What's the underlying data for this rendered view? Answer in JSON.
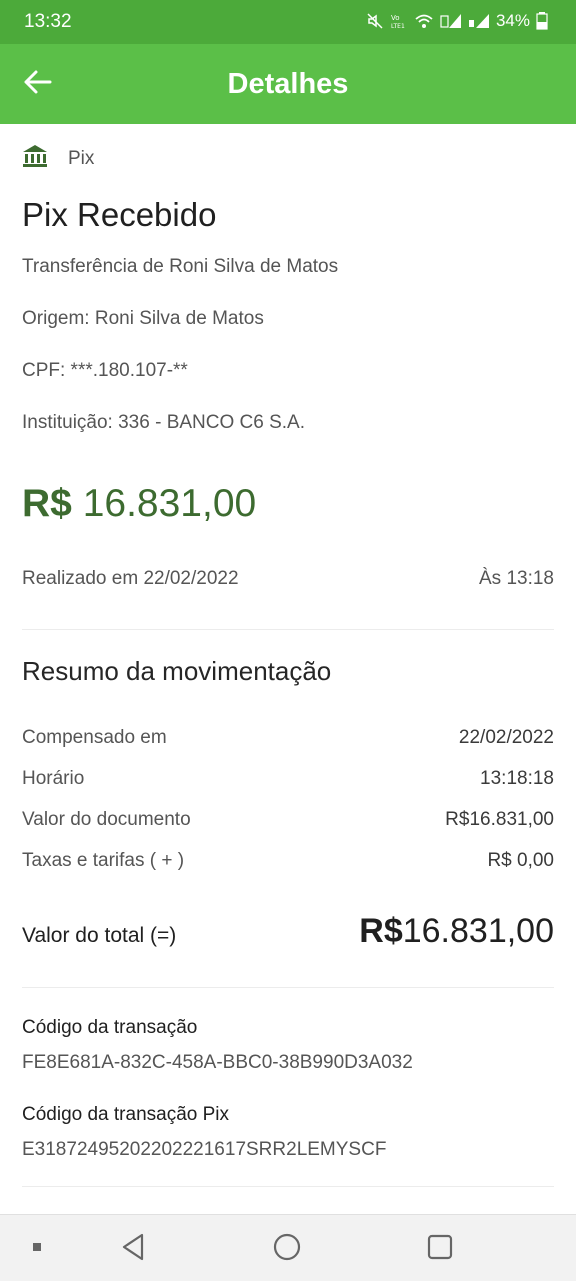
{
  "status_bar": {
    "time": "13:32",
    "battery_percent": "34%",
    "icons": [
      "mute-icon",
      "volte-icon",
      "wifi-icon",
      "signal-icon",
      "signal-icon",
      "battery-icon"
    ]
  },
  "app_bar": {
    "title": "Detalhes",
    "back_icon": "arrow-left-icon",
    "color": "#5bbf48"
  },
  "transaction": {
    "category_icon": "bank-icon",
    "category": "Pix",
    "title": "Pix Recebido",
    "description": "Transferência de Roni Silva de Matos",
    "origin": "Origem: Roni Silva de Matos",
    "cpf": "CPF: ***.180.107-**",
    "institution": "Instituição: 336 - BANCO C6 S.A.",
    "amount_currency": "R$",
    "amount_value": "16.831,00",
    "amount_color": "#3d6b30",
    "date_text": "Realizado em 22/02/2022",
    "time_text": "Às 13:18"
  },
  "summary": {
    "title": "Resumo da movimentação",
    "rows": [
      {
        "label": "Compensado em",
        "value": "22/02/2022"
      },
      {
        "label": "Horário",
        "value": "13:18:18"
      },
      {
        "label": "Valor do documento",
        "value": "R$16.831,00"
      },
      {
        "label": "Taxas e tarifas ( + )",
        "value": "R$ 0,00"
      }
    ],
    "total_label": "Valor do total (=)",
    "total_currency": "R$",
    "total_value": "16.831,00"
  },
  "codes": {
    "transaction_label": "Código da transação",
    "transaction_value": "FE8E681A-832C-458A-BBC0-38B990D3A032",
    "pix_label": "Código da transação Pix",
    "pix_value": "E31872495202202221617SRR2LEMYSCF"
  },
  "nav_bar": {
    "icons": [
      "recent-dot-icon",
      "back-triangle-icon",
      "home-circle-icon",
      "overview-square-icon"
    ]
  }
}
